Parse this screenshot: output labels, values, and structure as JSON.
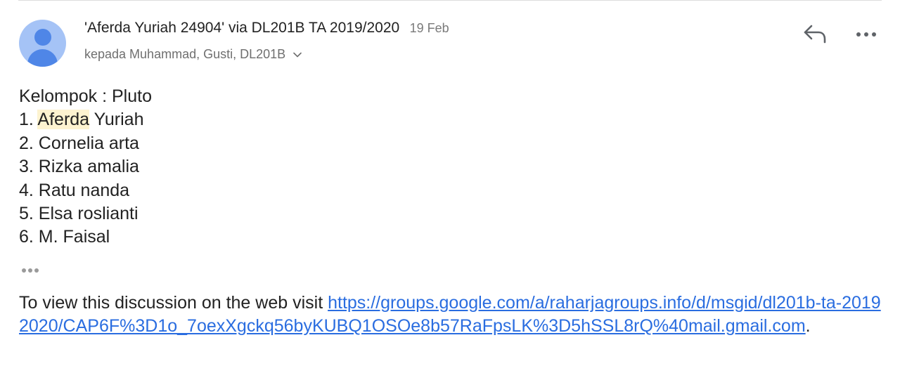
{
  "header": {
    "sender": "'Aferda Yuriah 24904' via DL201B TA 2019/2020",
    "date": "19 Feb",
    "recipients": "kepada Muhammad, Gusti, DL201B"
  },
  "icons": {
    "avatar": "person-avatar-icon",
    "reply": "reply-arrow-icon",
    "more": "more-horizontal-icon",
    "chevron": "chevron-down-icon",
    "trimmed": "ellipsis-icon"
  },
  "colors": {
    "avatar_bg": "#a5c3f6",
    "avatar_fg": "#4f86e7",
    "link": "#2a6de0",
    "highlight": "#fdf3d0"
  },
  "body": {
    "group_line": "Kelompok : Pluto",
    "members": [
      {
        "prefix": "1. ",
        "highlight": "Aferda",
        "rest": " Yuriah"
      },
      {
        "prefix": "2. ",
        "text": "Cornelia arta"
      },
      {
        "prefix": "3. ",
        "text": "Rizka amalia"
      },
      {
        "prefix": "4. ",
        "text": "Ratu nanda"
      },
      {
        "prefix": "5. ",
        "text": "Elsa roslianti"
      },
      {
        "prefix": "6. ",
        "text": "M. Faisal"
      }
    ]
  },
  "footer": {
    "lead_text": "To view this discussion on the web visit ",
    "link_text": "https://groups.google.com/a/raharjagroups.info/d/msgid/dl201b-ta-20192020/CAP6F%3D1o_7oexXgckq56byKUBQ1OSOe8b57RaFpsLK%3D5hSSL8rQ%40mail.gmail.com",
    "trailing": "."
  }
}
